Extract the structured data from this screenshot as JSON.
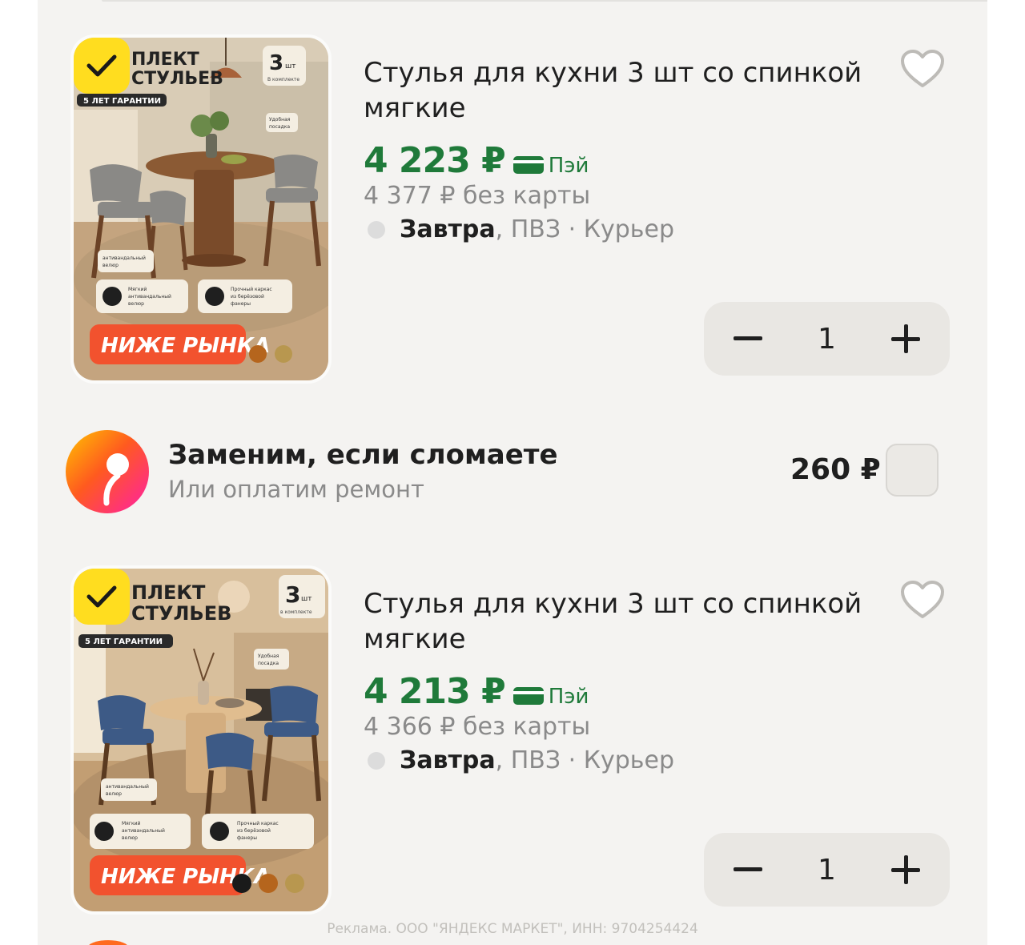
{
  "products": [
    {
      "title": "Стулья для кухни 3 шт со спинкой мягкие",
      "price": "4 223 ₽",
      "pay_label": "Пэй",
      "old_price": "4 377 ₽  без карты",
      "delivery_bold": "Завтра",
      "delivery_rest": ", ПВЗ · Курьер",
      "quantity": "1",
      "image": {
        "headline_line1": "ПЛЕКТ",
        "headline_line2": "СТУЛЬЕВ",
        "count": "3",
        "count_unit": "шт",
        "count_sub": "В комплекте",
        "warranty": "5 ЛЕТ ГАРАНТИИ",
        "tag_fit_1": "Удобная",
        "tag_fit_2": "посадка",
        "tag_fabric_1": "антивандальный",
        "tag_fabric_2": "велюр",
        "feat1_1": "Мягкий",
        "feat1_2": "антивандальный",
        "feat1_3": "велюр",
        "feat2_1": "Прочный каркас",
        "feat2_2": "из берёзовой",
        "feat2_3": "фанеры",
        "promo": "НИЖЕ РЫНКА",
        "chair_color": "#8a8986",
        "bg_color": "#c9b79c"
      }
    },
    {
      "title": "Стулья для кухни 3 шт со спинкой мягкие",
      "price": "4 213 ₽",
      "pay_label": "Пэй",
      "old_price": "4 366 ₽  без карты",
      "delivery_bold": "Завтра",
      "delivery_rest": ", ПВЗ · Курьер",
      "quantity": "1",
      "image": {
        "headline_line1": "ПЛЕКТ",
        "headline_line2": "СТУЛЬЕВ",
        "count": "3",
        "count_unit": "шт",
        "count_sub": "в комплекте",
        "warranty": "5 ЛЕТ ГАРАНТИИ",
        "tag_fit_1": "Удобная",
        "tag_fit_2": "посадка",
        "tag_fabric_1": "антивандальный",
        "tag_fabric_2": "велюр",
        "feat1_1": "Мягкий",
        "feat1_2": "антивандальный",
        "feat1_3": "велюр",
        "feat2_1": "Прочный каркас",
        "feat2_2": "из берёзовой",
        "feat2_3": "фанеры",
        "promo": "НИЖЕ РЫНКА",
        "chair_color": "#3d5a86",
        "bg_color": "#cdb596"
      }
    }
  ],
  "insurance": {
    "title": "Заменим, если сломаете",
    "subtitle": "Или оплатим ремонт",
    "price": "260 ₽"
  },
  "ad_note": "Реклама. ООО \"ЯНДЕКС МАРКЕТ\", ИНН: 9704254424",
  "colors": {
    "price_green": "#1f7a3a",
    "badge_yellow": "#ffdd1f",
    "promo_orange": "#f2522e"
  }
}
